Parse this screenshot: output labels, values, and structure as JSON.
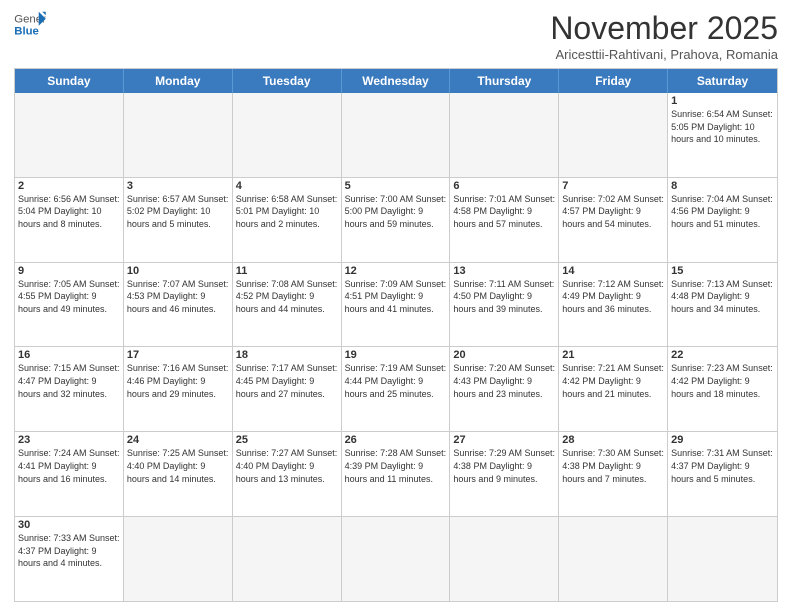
{
  "header": {
    "logo_general": "General",
    "logo_blue": "Blue",
    "month": "November 2025",
    "location": "Aricesttii-Rahtivani, Prahova, Romania"
  },
  "days_of_week": [
    "Sunday",
    "Monday",
    "Tuesday",
    "Wednesday",
    "Thursday",
    "Friday",
    "Saturday"
  ],
  "weeks": [
    [
      {
        "day": "",
        "info": ""
      },
      {
        "day": "",
        "info": ""
      },
      {
        "day": "",
        "info": ""
      },
      {
        "day": "",
        "info": ""
      },
      {
        "day": "",
        "info": ""
      },
      {
        "day": "",
        "info": ""
      },
      {
        "day": "1",
        "info": "Sunrise: 6:54 AM\nSunset: 5:05 PM\nDaylight: 10 hours and 10 minutes."
      }
    ],
    [
      {
        "day": "2",
        "info": "Sunrise: 6:56 AM\nSunset: 5:04 PM\nDaylight: 10 hours and 8 minutes."
      },
      {
        "day": "3",
        "info": "Sunrise: 6:57 AM\nSunset: 5:02 PM\nDaylight: 10 hours and 5 minutes."
      },
      {
        "day": "4",
        "info": "Sunrise: 6:58 AM\nSunset: 5:01 PM\nDaylight: 10 hours and 2 minutes."
      },
      {
        "day": "5",
        "info": "Sunrise: 7:00 AM\nSunset: 5:00 PM\nDaylight: 9 hours and 59 minutes."
      },
      {
        "day": "6",
        "info": "Sunrise: 7:01 AM\nSunset: 4:58 PM\nDaylight: 9 hours and 57 minutes."
      },
      {
        "day": "7",
        "info": "Sunrise: 7:02 AM\nSunset: 4:57 PM\nDaylight: 9 hours and 54 minutes."
      },
      {
        "day": "8",
        "info": "Sunrise: 7:04 AM\nSunset: 4:56 PM\nDaylight: 9 hours and 51 minutes."
      }
    ],
    [
      {
        "day": "9",
        "info": "Sunrise: 7:05 AM\nSunset: 4:55 PM\nDaylight: 9 hours and 49 minutes."
      },
      {
        "day": "10",
        "info": "Sunrise: 7:07 AM\nSunset: 4:53 PM\nDaylight: 9 hours and 46 minutes."
      },
      {
        "day": "11",
        "info": "Sunrise: 7:08 AM\nSunset: 4:52 PM\nDaylight: 9 hours and 44 minutes."
      },
      {
        "day": "12",
        "info": "Sunrise: 7:09 AM\nSunset: 4:51 PM\nDaylight: 9 hours and 41 minutes."
      },
      {
        "day": "13",
        "info": "Sunrise: 7:11 AM\nSunset: 4:50 PM\nDaylight: 9 hours and 39 minutes."
      },
      {
        "day": "14",
        "info": "Sunrise: 7:12 AM\nSunset: 4:49 PM\nDaylight: 9 hours and 36 minutes."
      },
      {
        "day": "15",
        "info": "Sunrise: 7:13 AM\nSunset: 4:48 PM\nDaylight: 9 hours and 34 minutes."
      }
    ],
    [
      {
        "day": "16",
        "info": "Sunrise: 7:15 AM\nSunset: 4:47 PM\nDaylight: 9 hours and 32 minutes."
      },
      {
        "day": "17",
        "info": "Sunrise: 7:16 AM\nSunset: 4:46 PM\nDaylight: 9 hours and 29 minutes."
      },
      {
        "day": "18",
        "info": "Sunrise: 7:17 AM\nSunset: 4:45 PM\nDaylight: 9 hours and 27 minutes."
      },
      {
        "day": "19",
        "info": "Sunrise: 7:19 AM\nSunset: 4:44 PM\nDaylight: 9 hours and 25 minutes."
      },
      {
        "day": "20",
        "info": "Sunrise: 7:20 AM\nSunset: 4:43 PM\nDaylight: 9 hours and 23 minutes."
      },
      {
        "day": "21",
        "info": "Sunrise: 7:21 AM\nSunset: 4:42 PM\nDaylight: 9 hours and 21 minutes."
      },
      {
        "day": "22",
        "info": "Sunrise: 7:23 AM\nSunset: 4:42 PM\nDaylight: 9 hours and 18 minutes."
      }
    ],
    [
      {
        "day": "23",
        "info": "Sunrise: 7:24 AM\nSunset: 4:41 PM\nDaylight: 9 hours and 16 minutes."
      },
      {
        "day": "24",
        "info": "Sunrise: 7:25 AM\nSunset: 4:40 PM\nDaylight: 9 hours and 14 minutes."
      },
      {
        "day": "25",
        "info": "Sunrise: 7:27 AM\nSunset: 4:40 PM\nDaylight: 9 hours and 13 minutes."
      },
      {
        "day": "26",
        "info": "Sunrise: 7:28 AM\nSunset: 4:39 PM\nDaylight: 9 hours and 11 minutes."
      },
      {
        "day": "27",
        "info": "Sunrise: 7:29 AM\nSunset: 4:38 PM\nDaylight: 9 hours and 9 minutes."
      },
      {
        "day": "28",
        "info": "Sunrise: 7:30 AM\nSunset: 4:38 PM\nDaylight: 9 hours and 7 minutes."
      },
      {
        "day": "29",
        "info": "Sunrise: 7:31 AM\nSunset: 4:37 PM\nDaylight: 9 hours and 5 minutes."
      }
    ],
    [
      {
        "day": "30",
        "info": "Sunrise: 7:33 AM\nSunset: 4:37 PM\nDaylight: 9 hours and 4 minutes."
      },
      {
        "day": "",
        "info": ""
      },
      {
        "day": "",
        "info": ""
      },
      {
        "day": "",
        "info": ""
      },
      {
        "day": "",
        "info": ""
      },
      {
        "day": "",
        "info": ""
      },
      {
        "day": "",
        "info": ""
      }
    ]
  ]
}
